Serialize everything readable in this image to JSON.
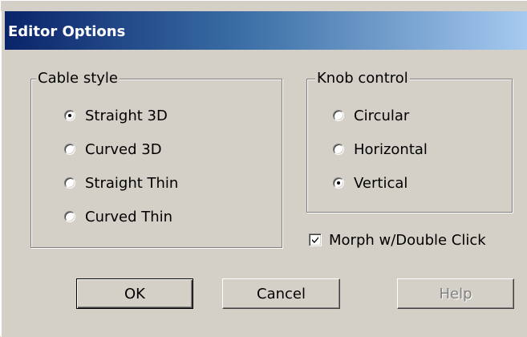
{
  "window": {
    "title": "Editor Options"
  },
  "cable_style": {
    "caption": "Cable style",
    "options": [
      {
        "label": "Straight 3D",
        "checked": true
      },
      {
        "label": "Curved 3D",
        "checked": false
      },
      {
        "label": "Straight Thin",
        "checked": false
      },
      {
        "label": "Curved Thin",
        "checked": false
      }
    ]
  },
  "knob_control": {
    "caption": "Knob control",
    "options": [
      {
        "label": "Circular",
        "checked": false
      },
      {
        "label": "Horizontal",
        "checked": false
      },
      {
        "label": "Vertical",
        "checked": true
      }
    ]
  },
  "morph": {
    "label": "Morph w/Double Click",
    "checked": true
  },
  "buttons": {
    "ok": "OK",
    "cancel": "Cancel",
    "help": "Help"
  }
}
